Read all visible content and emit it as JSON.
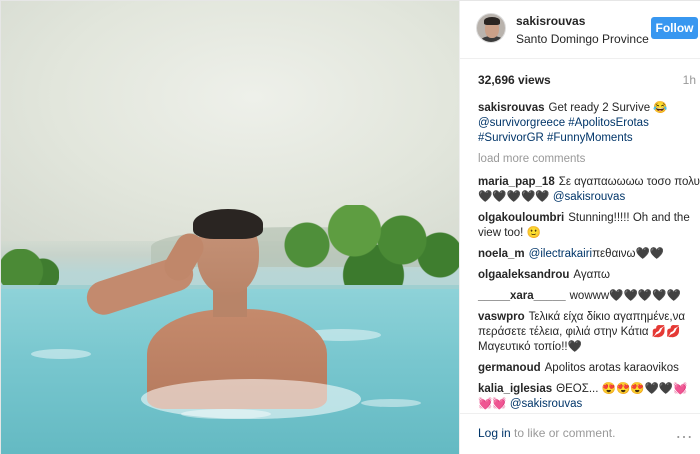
{
  "author": {
    "username": "sakisrouvas",
    "location": "Santo Domingo Province",
    "follow_label": "Follow"
  },
  "stats": {
    "views": "32,696 views",
    "age": "1h"
  },
  "caption": {
    "user": "sakisrouvas",
    "text": "Get ready 2 Survive 😂",
    "mentions": "@survivorgreece #ApolitosErotas #SurvivorGR #FunnyMoments"
  },
  "load_more_label": "load more comments",
  "comments": [
    {
      "user": "maria_pap_18",
      "text": "Σε αγαπαωωωω τοσο πολυ 🖤🖤🖤🖤🖤",
      "mention": "@sakisrouvas"
    },
    {
      "user": "olgakouloumbri",
      "text": "Stunning!!!!! Oh and the view too! 🙂",
      "mention": ""
    },
    {
      "user": "noela_m",
      "text": "πεθαινω🖤🖤",
      "mention": "@ilectrakairi"
    },
    {
      "user": "olgaaleksandrou",
      "text": "Αγαπω",
      "mention": ""
    },
    {
      "user": "_____xara_____",
      "text": "wowww🖤🖤🖤🖤🖤",
      "mention": ""
    },
    {
      "user": "vaswpro",
      "text": "Τελικά είχα δίκιο αγαπημένε,να περάσετε τέλεια, φιλιά στην Κάτια 💋💋Μαγευτικό τοπίο!!🖤",
      "mention": ""
    },
    {
      "user": "germanoud",
      "text": "Apolitos arotas karaovikos",
      "mention": ""
    },
    {
      "user": "kalia_iglesias",
      "text": "ΘΕΟΣ... 😍😍😍🖤🖤💓💓💓",
      "mention": "@sakisrouvas"
    }
  ],
  "footer": {
    "login_link": "Log in",
    "login_rest": "to like or comment.",
    "more_icon": "more-options-icon"
  }
}
